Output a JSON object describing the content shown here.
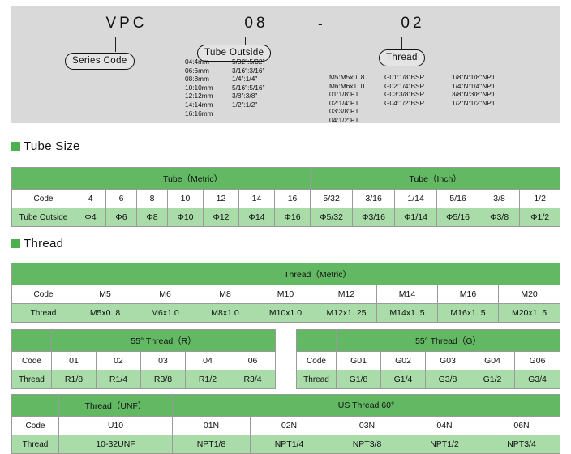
{
  "code_panel": {
    "segments": [
      {
        "text": "VPC",
        "bubble": "Series Code"
      },
      {
        "text": "08",
        "bubble": "Tube Outside"
      },
      {
        "text": "02",
        "bubble": "Thread"
      }
    ],
    "separator": "-",
    "tube_outside_col1": "04:4mm\n06:6mm\n08:8mm\n10:10mm\n12:12mm\n14:14mm\n16:16mm",
    "tube_outside_col2": "5/32″:5/32″\n3/16″:3/16″\n1/4″:1/4″\n5/16″:5/16″\n3/8″:3/8″\n1/2″:1/2″",
    "thread_col1": "M5:M5x0. 8\nM6:M6x1. 0\n01:1/8″PT\n02:1/4″PT\n03:3/8″PT\n04:1/2″PT",
    "thread_col2": "G01:1/8″BSP\nG02:1/4″BSP\nG03:3/8″BSP\nG04:1/2″BSP",
    "thread_col3": "1/8″N:1/8″NPT\n1/4″N:1/4″NPT\n3/8″N:3/8″NPT\n1/2″N:1/2″NPT"
  },
  "sections": {
    "tube_size": "Tube Size",
    "thread": "Thread"
  },
  "tube_size_table": {
    "group_metric": "Tube（Metric）",
    "group_inch": "Tube（Inch）",
    "row_code_label": "Code",
    "row_outside_label": "Tube Outside",
    "codes": [
      "4",
      "6",
      "8",
      "10",
      "12",
      "14",
      "16",
      "5/32",
      "3/16",
      "1/14",
      "5/16",
      "3/8",
      "1/2"
    ],
    "outside": [
      "Φ4",
      "Φ6",
      "Φ8",
      "Φ10",
      "Φ12",
      "Φ14",
      "Φ16",
      "Φ5/32",
      "Φ3/16",
      "Φ1/14",
      "Φ5/16",
      "Φ3/8",
      "Φ1/2"
    ]
  },
  "thread_metric_table": {
    "group": "Thread（Metric）",
    "row_code_label": "Code",
    "row_thread_label": "Thread",
    "codes": [
      "M5",
      "M6",
      "M8",
      "M10",
      "M12",
      "M14",
      "M16",
      "M20"
    ],
    "threads": [
      "M5x0. 8",
      "M6x1.0",
      "M8x1.0",
      "M10x1.0",
      "M12x1. 25",
      "M14x1. 5",
      "M16x1. 5",
      "M20x1. 5"
    ]
  },
  "thread_r_table": {
    "group": "55° Thread（R）",
    "row_code_label": "Code",
    "row_thread_label": "Thread",
    "codes": [
      "01",
      "02",
      "03",
      "04",
      "06"
    ],
    "threads": [
      "R1/8",
      "R1/4",
      "R3/8",
      "R1/2",
      "R3/4"
    ]
  },
  "thread_g_table": {
    "group": "55° Thread（G）",
    "row_code_label": "Code",
    "row_thread_label": "Thread",
    "codes": [
      "G01",
      "G02",
      "G03",
      "G04",
      "G06"
    ],
    "threads": [
      "G1/8",
      "G1/4",
      "G3/8",
      "G1/2",
      "G3/4"
    ]
  },
  "unf_table": {
    "group_unf": "Thread（UNF）",
    "group_us": "US Thread 60°",
    "row_code_label": "Code",
    "row_thread_label": "Thread",
    "codes": [
      "U10",
      "01N",
      "02N",
      "03N",
      "04N",
      "06N"
    ],
    "threads": [
      "10-32UNF",
      "NPT1/8",
      "NPT1/4",
      "NPT3/8",
      "NPT1/2",
      "NPT3/4"
    ]
  },
  "colors": {
    "header_green": "#63b863",
    "cell_green": "#a9dca9",
    "panel_gray": "#d9d9d9",
    "bullet_green": "#4caf50"
  }
}
